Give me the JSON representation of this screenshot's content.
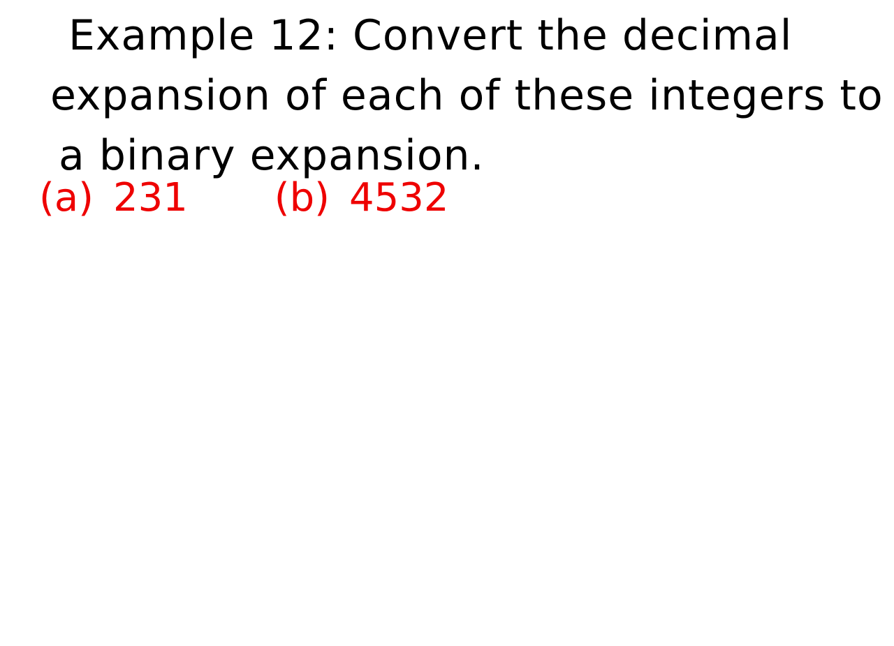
{
  "problem": {
    "lines": [
      "Example 12: Convert the decimal",
      "expansion of each of these integers to",
      "a binary expansion."
    ]
  },
  "parts": [
    {
      "label": "(a)",
      "value": "231"
    },
    {
      "label": "(b)",
      "value": "4532"
    }
  ],
  "colors": {
    "problem_text": "#000000",
    "parts_text": "#ee0000",
    "background": "#ffffff"
  }
}
